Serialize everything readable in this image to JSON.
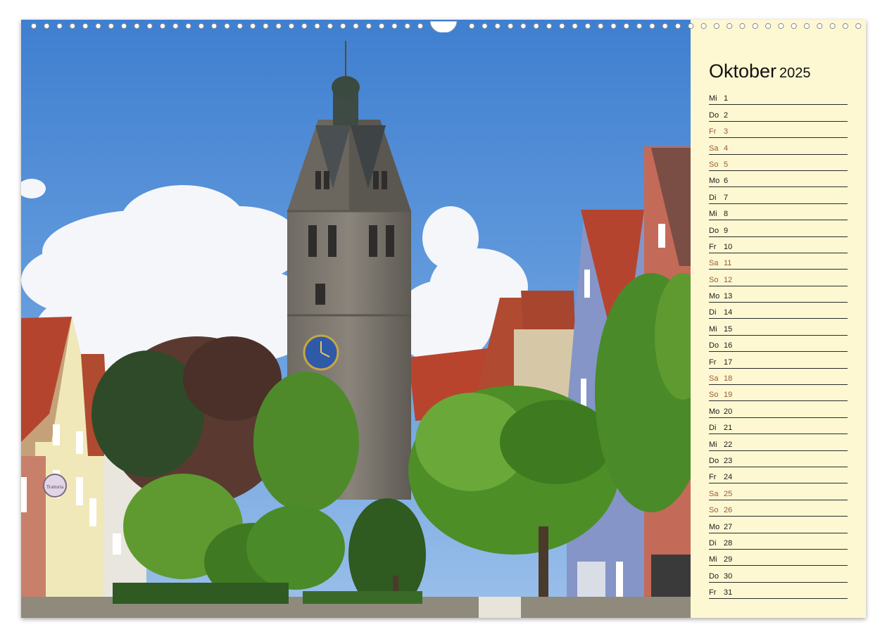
{
  "calendar": {
    "month": "Oktober",
    "year": "2025",
    "days": [
      {
        "abbr": "Mi",
        "num": "1",
        "weekend": false
      },
      {
        "abbr": "Do",
        "num": "2",
        "weekend": false
      },
      {
        "abbr": "Fr",
        "num": "3",
        "weekend": true
      },
      {
        "abbr": "Sa",
        "num": "4",
        "weekend": true
      },
      {
        "abbr": "So",
        "num": "5",
        "weekend": true
      },
      {
        "abbr": "Mo",
        "num": "6",
        "weekend": false
      },
      {
        "abbr": "Di",
        "num": "7",
        "weekend": false
      },
      {
        "abbr": "Mi",
        "num": "8",
        "weekend": false
      },
      {
        "abbr": "Do",
        "num": "9",
        "weekend": false
      },
      {
        "abbr": "Fr",
        "num": "10",
        "weekend": false
      },
      {
        "abbr": "Sa",
        "num": "11",
        "weekend": true
      },
      {
        "abbr": "So",
        "num": "12",
        "weekend": true
      },
      {
        "abbr": "Mo",
        "num": "13",
        "weekend": false
      },
      {
        "abbr": "Di",
        "num": "14",
        "weekend": false
      },
      {
        "abbr": "Mi",
        "num": "15",
        "weekend": false
      },
      {
        "abbr": "Do",
        "num": "16",
        "weekend": false
      },
      {
        "abbr": "Fr",
        "num": "17",
        "weekend": false
      },
      {
        "abbr": "Sa",
        "num": "18",
        "weekend": true
      },
      {
        "abbr": "So",
        "num": "19",
        "weekend": true
      },
      {
        "abbr": "Mo",
        "num": "20",
        "weekend": false
      },
      {
        "abbr": "Di",
        "num": "21",
        "weekend": false
      },
      {
        "abbr": "Mi",
        "num": "22",
        "weekend": false
      },
      {
        "abbr": "Do",
        "num": "23",
        "weekend": false
      },
      {
        "abbr": "Fr",
        "num": "24",
        "weekend": false
      },
      {
        "abbr": "Sa",
        "num": "25",
        "weekend": true
      },
      {
        "abbr": "So",
        "num": "26",
        "weekend": true
      },
      {
        "abbr": "Mo",
        "num": "27",
        "weekend": false
      },
      {
        "abbr": "Di",
        "num": "28",
        "weekend": false
      },
      {
        "abbr": "Mi",
        "num": "29",
        "weekend": false
      },
      {
        "abbr": "Do",
        "num": "30",
        "weekend": false
      },
      {
        "abbr": "Fr",
        "num": "31",
        "weekend": false
      }
    ]
  },
  "colors": {
    "sidebar_bg": "#fdf8d2",
    "weekend_text": "#9a5a3a",
    "weekday_text": "#1a1a1a",
    "rule_line": "#2a2a2a",
    "sky": "#4f8bd6"
  },
  "photo": {
    "subject_icons": [
      "church-tower-icon",
      "clock-icon",
      "tree-icon",
      "house-icon",
      "cloud-icon"
    ],
    "sign_text": "Trattoria"
  }
}
